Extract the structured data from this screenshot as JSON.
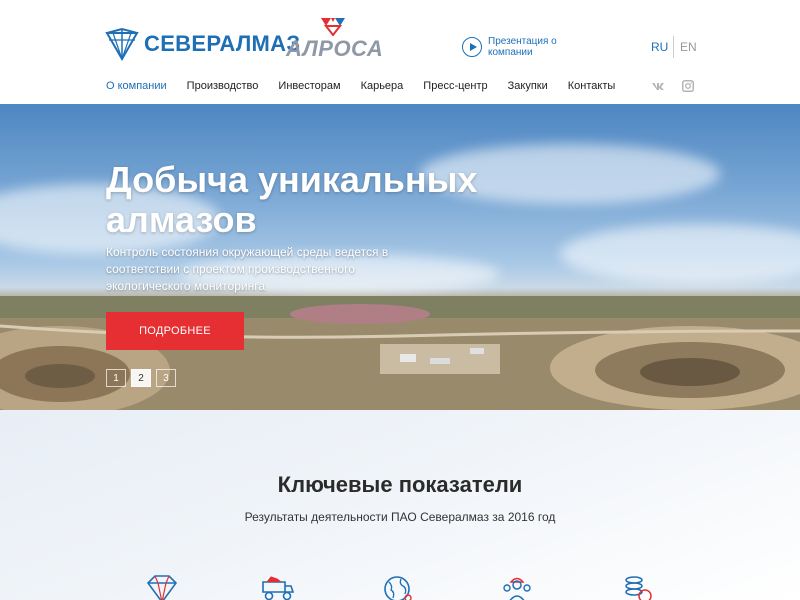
{
  "header": {
    "logo_severalmaz": "СЕВЕРАЛМАЗ",
    "logo_alrosa": "АЛРОСА",
    "presentation_label": "Презентация о компании",
    "lang_ru": "RU",
    "lang_en": "EN"
  },
  "nav": {
    "items": [
      {
        "label": "О компании",
        "active": true
      },
      {
        "label": "Производство",
        "active": false
      },
      {
        "label": "Инвесторам",
        "active": false
      },
      {
        "label": "Карьера",
        "active": false
      },
      {
        "label": "Пресс-центр",
        "active": false
      },
      {
        "label": "Закупки",
        "active": false
      },
      {
        "label": "Контакты",
        "active": false
      }
    ],
    "social_icons": [
      "vk-icon",
      "instagram-icon"
    ]
  },
  "hero": {
    "title": "Добыча уникальных алмазов",
    "subtitle": "Контроль состояния окружающей среды ведется в соответствии с проектом производственного экологического мониторинга",
    "button_label": "ПОДРОБНЕЕ",
    "slides": [
      "1",
      "2",
      "3"
    ],
    "active_slide": 2
  },
  "indicators": {
    "title": "Ключевые показатели",
    "subtitle": "Результаты деятельности ПАО Севералмаз за 2016 год",
    "icons": [
      "diamond-icon",
      "dump-truck-icon",
      "globe-icon",
      "workers-icon",
      "coins-icon"
    ]
  },
  "colors": {
    "brand_blue": "#1f6fb5",
    "accent_red": "#e52f33",
    "alrosa_grey": "#8e98a7"
  }
}
